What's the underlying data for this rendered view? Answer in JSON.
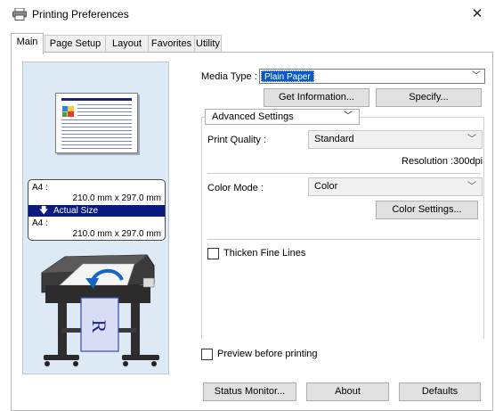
{
  "window": {
    "title": "Printing Preferences",
    "close_label": "✕",
    "icon": "printer-icon"
  },
  "tabs": [
    {
      "label": "Main",
      "active": true
    },
    {
      "label": "Page Setup",
      "active": false
    },
    {
      "label": "Layout",
      "active": false
    },
    {
      "label": "Favorites",
      "active": false
    },
    {
      "label": "Utility",
      "active": false
    }
  ],
  "preview": {
    "input_size_label": "A4 :",
    "input_size_dims": "210.0 mm x 297.0 mm",
    "scaling": "Actual Size",
    "output_size_label": "A4 :",
    "output_size_dims": "210.0 mm x 297.0 mm",
    "printer_sheet_letter": "R",
    "icons": [
      "printer-illustration-icon",
      "feed-arrow-icon",
      "down-arrow-icon"
    ]
  },
  "media": {
    "label": "Media Type :",
    "selected": "Plain Paper",
    "get_info_label": "Get Information...",
    "specify_label": "Specify..."
  },
  "advanced": {
    "dropdown_label": "Advanced Settings",
    "print_quality_label": "Print Quality :",
    "print_quality_value": "Standard",
    "resolution_text": "Resolution :300dpi",
    "color_mode_label": "Color Mode :",
    "color_mode_value": "Color",
    "color_settings_label": "Color Settings...",
    "thicken_lines_label": "Thicken Fine Lines",
    "thicken_lines_checked": false
  },
  "preview_before_printing": {
    "label": "Preview before printing",
    "checked": false
  },
  "footer": {
    "status_monitor_label": "Status Monitor...",
    "about_label": "About",
    "defaults_label": "Defaults"
  },
  "colors": {
    "selection_blue": "#0a59c8",
    "scaling_bar": "#0b1a80",
    "preview_bg": "#dde9f5",
    "button_bg": "#e1e1e1"
  }
}
